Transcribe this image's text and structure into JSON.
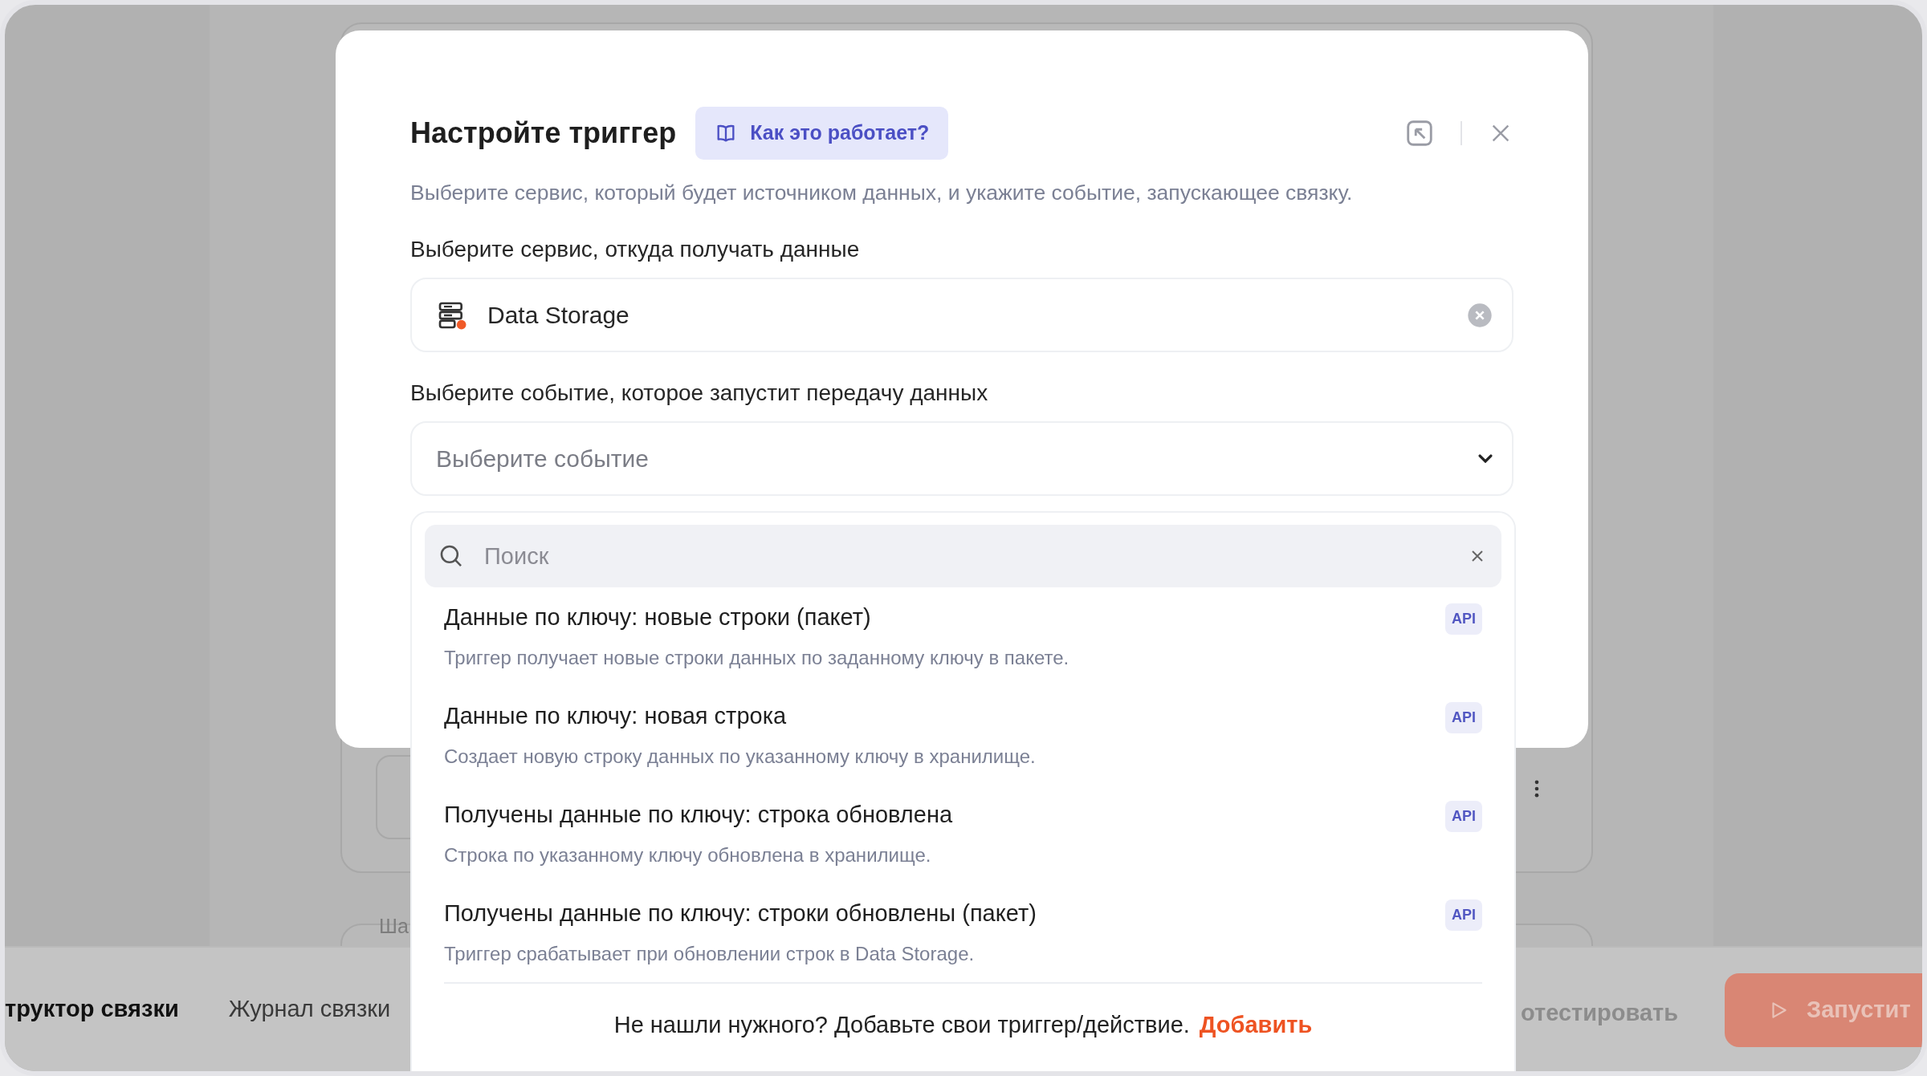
{
  "background": {
    "tabs": [
      {
        "label": "труктор связки",
        "selected": true
      },
      {
        "label": "Журнал связки",
        "selected": false
      }
    ],
    "step_label": "Ша",
    "test_button": "отестировать",
    "run_button": "Запустит"
  },
  "dialog": {
    "title": "Настройте триггер",
    "help_button": "Как это работает?",
    "subtitle": "Выберите сервис, который будет источником данных, и укажите событие, запускающее связку.",
    "service_label": "Выберите сервис, откуда получать данные",
    "service": {
      "value": "Data Storage"
    },
    "event_label": "Выберите событие, которое запустит передачу данных",
    "event_select": {
      "placeholder": "Выберите событие"
    },
    "search": {
      "placeholder": "Поиск"
    },
    "events": [
      {
        "title": "Данные по ключу: новые строки (пакет)",
        "description": "Триггер получает новые строки данных по заданному ключу в пакете.",
        "badge": "API"
      },
      {
        "title": "Данные по ключу: новая строка",
        "description": "Создает новую строку данных по указанному ключу в хранилище.",
        "badge": "API"
      },
      {
        "title": "Получены данные по ключу: строка обновлена",
        "description": "Строка по указанному ключу обновлена в хранилище.",
        "badge": "API"
      },
      {
        "title": "Получены данные по ключу: строки обновлены (пакет)",
        "description": "Триггер срабатывает при обновлении строк в Data Storage.",
        "badge": "API"
      }
    ],
    "footer": {
      "text": "Не нашли нужного? Добавьте свои триггер/действие.",
      "link": "Добавить"
    }
  }
}
